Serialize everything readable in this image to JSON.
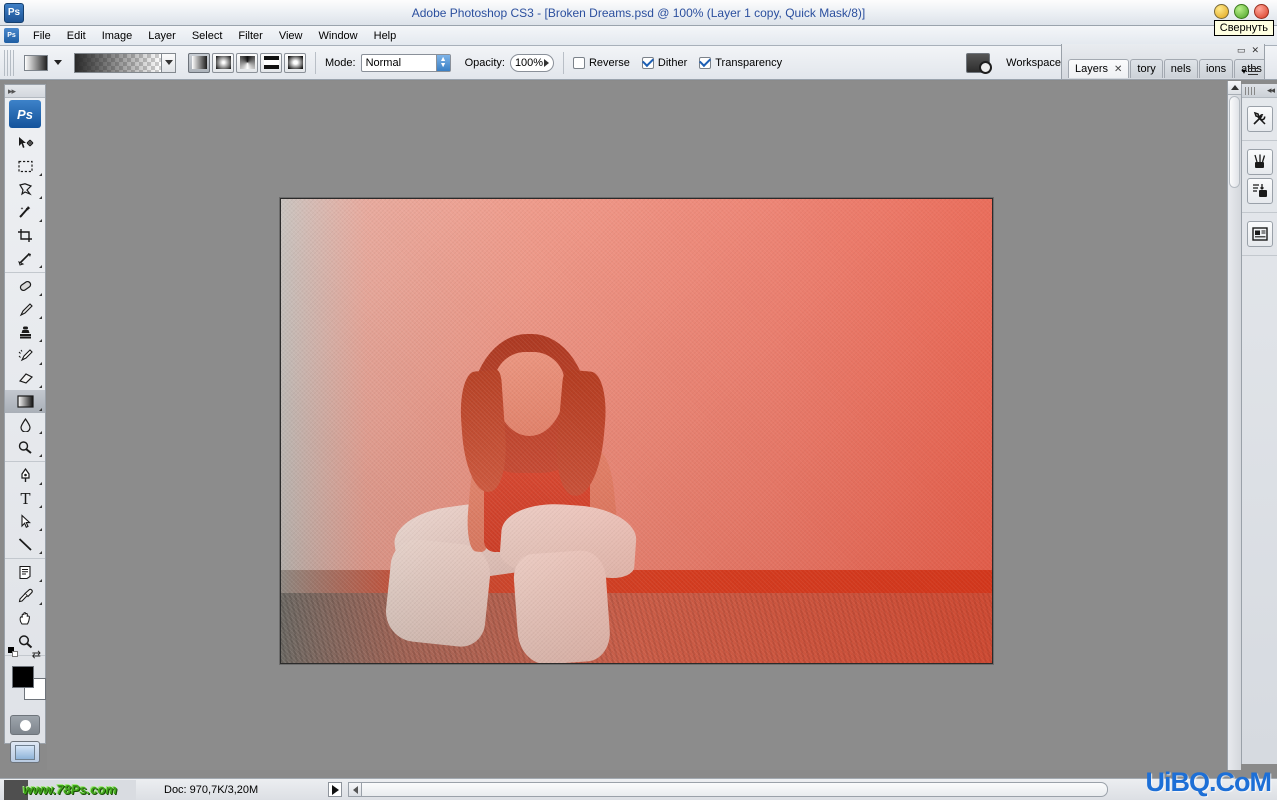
{
  "titlebar": {
    "title": "Adobe Photoshop CS3 - [Broken Dreams.psd @ 100% (Layer 1 copy, Quick Mask/8)]",
    "app_icon": "Ps",
    "tooltip": "Свернуть",
    "buttons": [
      {
        "name": "minimize",
        "color": "#e0a41c"
      },
      {
        "name": "maximize",
        "color": "#4ba227"
      },
      {
        "name": "close",
        "color": "#d83b23"
      }
    ]
  },
  "menubar": {
    "doc_icon": "Ps",
    "items": [
      {
        "label": "File"
      },
      {
        "label": "Edit"
      },
      {
        "label": "Image"
      },
      {
        "label": "Layer"
      },
      {
        "label": "Select"
      },
      {
        "label": "Filter"
      },
      {
        "label": "View"
      },
      {
        "label": "Window"
      },
      {
        "label": "Help"
      }
    ]
  },
  "options_bar": {
    "tool": "gradient-tool",
    "gradient_types": [
      {
        "name": "linear-gradient",
        "active": true
      },
      {
        "name": "radial-gradient",
        "active": false
      },
      {
        "name": "angle-gradient",
        "active": false
      },
      {
        "name": "reflected-gradient",
        "active": false
      },
      {
        "name": "diamond-gradient",
        "active": false
      }
    ],
    "mode_label": "Mode:",
    "mode_value": "Normal",
    "opacity_label": "Opacity:",
    "opacity_value": "100%",
    "checkboxes": [
      {
        "label": "Reverse",
        "checked": false
      },
      {
        "label": "Dither",
        "checked": true
      },
      {
        "label": "Transparency",
        "checked": true
      }
    ],
    "bridge_label": "bridge-icon",
    "workspace_label": "Workspace"
  },
  "panel_dock": {
    "tabs": [
      {
        "label": "Layers",
        "active": true,
        "closable": true
      },
      {
        "label": "tory",
        "active": false,
        "closable": false
      },
      {
        "label": "nels",
        "active": false,
        "closable": false
      },
      {
        "label": "ions",
        "active": false,
        "closable": false
      },
      {
        "label": "aths",
        "active": false,
        "closable": false
      }
    ]
  },
  "toolbox": {
    "logo": "Ps",
    "groups": [
      {
        "tools": [
          {
            "name": "move-tool",
            "selected": false
          },
          {
            "name": "rectangular-marquee-tool",
            "selected": false
          },
          {
            "name": "lasso-tool",
            "selected": false
          },
          {
            "name": "magic-wand-tool",
            "selected": false
          },
          {
            "name": "crop-tool",
            "selected": false
          },
          {
            "name": "slice-tool",
            "selected": false
          }
        ]
      },
      {
        "tools": [
          {
            "name": "healing-brush-tool",
            "selected": false
          },
          {
            "name": "brush-tool",
            "selected": false
          },
          {
            "name": "clone-stamp-tool",
            "selected": false
          },
          {
            "name": "history-brush-tool",
            "selected": false
          },
          {
            "name": "eraser-tool",
            "selected": false
          },
          {
            "name": "gradient-tool",
            "selected": true
          },
          {
            "name": "blur-tool",
            "selected": false
          },
          {
            "name": "dodge-tool",
            "selected": false
          }
        ]
      },
      {
        "tools": [
          {
            "name": "pen-tool",
            "selected": false
          },
          {
            "name": "type-tool",
            "selected": false
          },
          {
            "name": "path-selection-tool",
            "selected": false
          },
          {
            "name": "line-tool",
            "selected": false
          }
        ]
      },
      {
        "tools": [
          {
            "name": "notes-tool",
            "selected": false
          },
          {
            "name": "eyedropper-tool",
            "selected": false
          },
          {
            "name": "hand-tool",
            "selected": false
          },
          {
            "name": "zoom-tool",
            "selected": false
          }
        ]
      }
    ],
    "foreground_color": "#000000",
    "background_color": "#ffffff",
    "quick_mask_active": true,
    "screen_mode": "standard"
  },
  "right_dock": {
    "icons": [
      {
        "name": "tool-presets-icon"
      },
      {
        "name": "brushes-icon"
      },
      {
        "name": "clone-source-icon"
      },
      {
        "name": "layer-comps-icon"
      }
    ]
  },
  "canvas": {
    "zoom": "100%",
    "document": "Broken Dreams.psd",
    "mode": "Quick Mask",
    "overlay_color": "#dc2819"
  },
  "statusbar": {
    "watermark_left": "www.78Ps.com",
    "doc_info": "Doc: 970,7K/3,20M",
    "watermark_right": "UiBQ.CoM"
  }
}
